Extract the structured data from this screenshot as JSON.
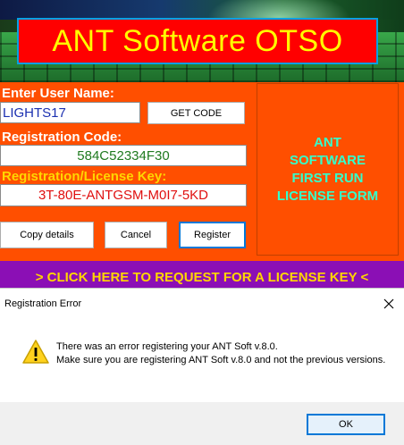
{
  "banner": {
    "title": "ANT Software OTSO"
  },
  "form": {
    "user_name_label": "Enter User Name:",
    "user_name_value": "LIGHTS17",
    "get_code_label": "GET CODE",
    "reg_code_label": "Registration Code:",
    "reg_code_value": "584C52334F30",
    "license_key_label": "Registration/License Key:",
    "license_key_value": "3T-80E-ANTGSM-M0I7-5KD",
    "copy_details_label": "Copy details",
    "cancel_label": "Cancel",
    "register_label": "Register"
  },
  "side_panel": {
    "text": "ANT\nSOFTWARE\nFIRST RUN\nLICENSE FORM"
  },
  "request_bar": {
    "text": "> CLICK HERE TO REQUEST FOR  A LICENSE KEY <"
  },
  "dialog": {
    "title": "Registration Error",
    "message_line1": "There was an error registering your ANT Soft v.8.0.",
    "message_line2": "Make sure you are registering ANT Soft v.8.0 and not the previous versions.",
    "ok_label": "OK",
    "icon": "warning-icon"
  },
  "colors": {
    "background": "#ff4f00",
    "title_bg": "#ff0000",
    "title_text": "#ffff00",
    "request_bar_bg": "#8b0fb5",
    "panel_text": "#33ffcc"
  }
}
